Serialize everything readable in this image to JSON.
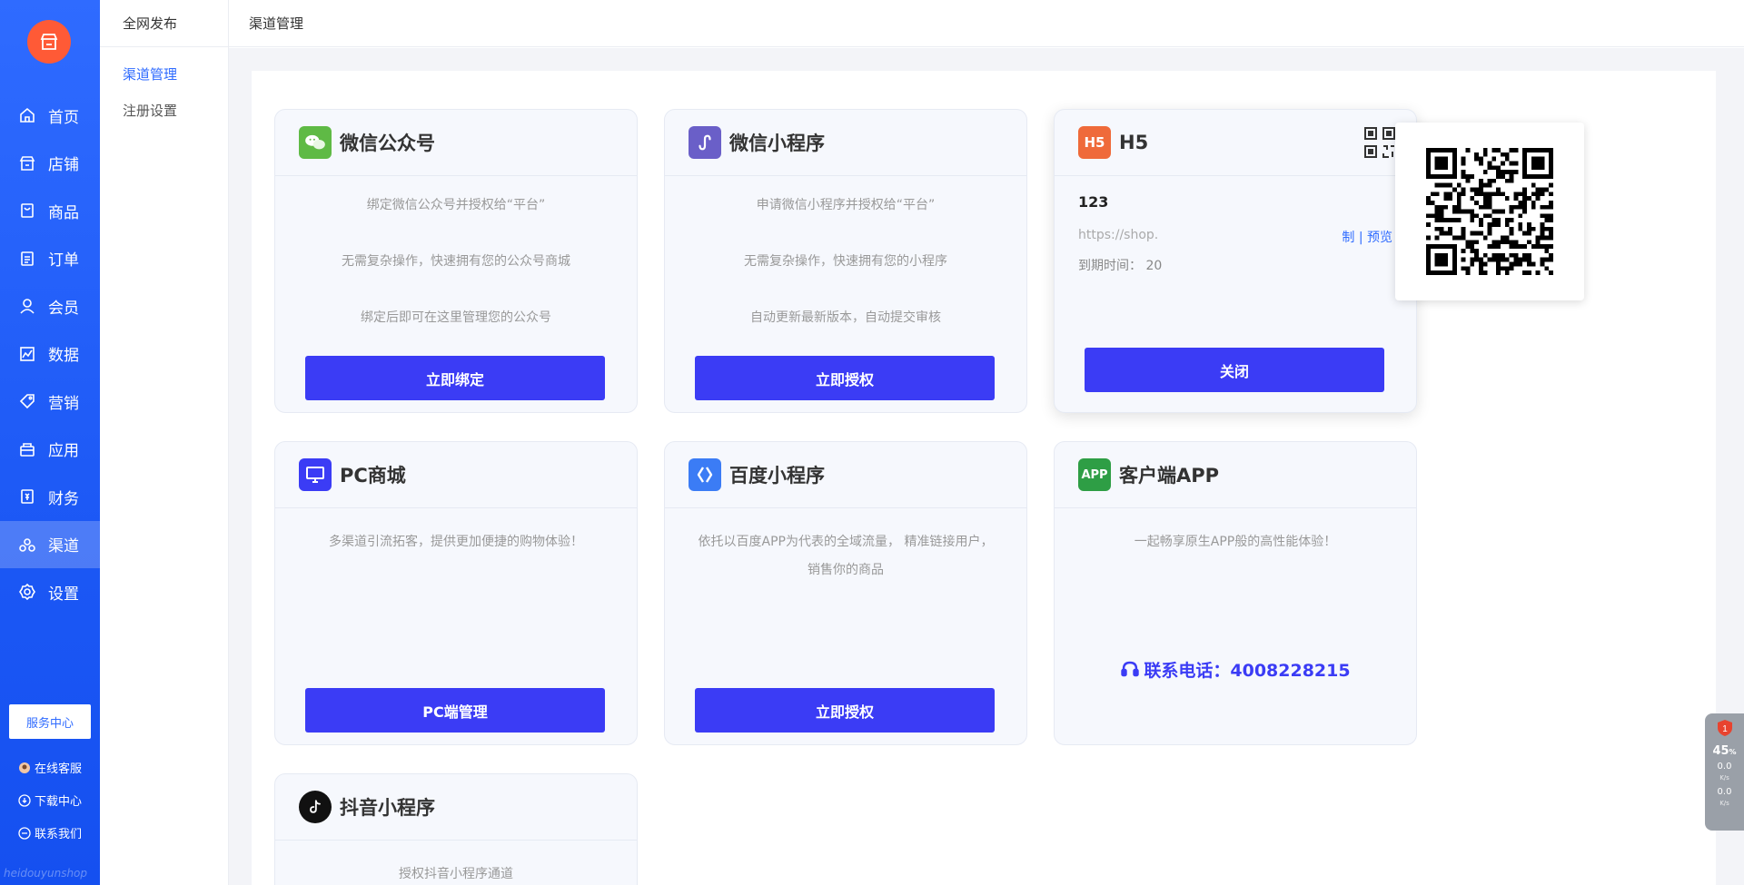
{
  "sidebar": {
    "nav": [
      {
        "label": "首页",
        "icon": "home-icon"
      },
      {
        "label": "店铺",
        "icon": "store-icon"
      },
      {
        "label": "商品",
        "icon": "goods-icon"
      },
      {
        "label": "订单",
        "icon": "order-icon"
      },
      {
        "label": "会员",
        "icon": "member-icon"
      },
      {
        "label": "数据",
        "icon": "chart-icon"
      },
      {
        "label": "营销",
        "icon": "tag-icon"
      },
      {
        "label": "应用",
        "icon": "app-icon"
      },
      {
        "label": "财务",
        "icon": "finance-icon"
      },
      {
        "label": "渠道",
        "icon": "channel-icon",
        "active": true
      },
      {
        "label": "设置",
        "icon": "settings-icon"
      }
    ],
    "service_center": "服务中心",
    "online_service": "在线客服",
    "download_center": "下载中心",
    "contact_us": "联系我们",
    "watermark": "heidouyunshop"
  },
  "submenu": {
    "title": "全网发布",
    "items": [
      "渠道管理",
      "注册设置"
    ]
  },
  "topbar": {
    "title": "渠道管理"
  },
  "cards": {
    "wechat_official": {
      "title": "微信公众号",
      "lines": [
        "绑定微信公众号并授权给“平台”",
        "无需复杂操作，快速拥有您的公众号商城",
        "绑定后即可在这里管理您的公众号"
      ],
      "button": "立即绑定"
    },
    "wechat_mini": {
      "title": "微信小程序",
      "lines": [
        "申请微信小程序并授权给“平台”",
        "无需复杂操作，快速拥有您的小程序",
        "自动更新最新版本，自动提交审核"
      ],
      "button": "立即授权"
    },
    "h5": {
      "icon_text": "H5",
      "title": "H5",
      "name": "123",
      "url": "https://shop.",
      "links": "制 | 预览",
      "expire": "到期时间：  20",
      "button": "关闭"
    },
    "pc": {
      "title": "PC商城",
      "desc": "多渠道引流拓客，提供更加便捷的购物体验！",
      "button": "PC端管理"
    },
    "baidu": {
      "title": "百度小程序",
      "desc": "依托以百度APP为代表的全域流量， 精准链接用户，销售你的商品",
      "button": "立即授权"
    },
    "app": {
      "icon_text": "APP",
      "title": "客户端APP",
      "desc": "一起畅享原生APP般的高性能体验！",
      "phone": "联系电话：4008228215"
    },
    "douyin": {
      "title": "抖音小程序",
      "desc": "授权抖音小程序通道"
    }
  },
  "widget": {
    "badge": "1",
    "percent": "45",
    "percent_unit": "%",
    "up": "0.0",
    "down": "0.0",
    "unit": "K/s"
  },
  "colors": {
    "sidebar": "#2f6bff",
    "button": "#3b3cf5",
    "logo": "#ff5a36",
    "wechat": "#5fba45",
    "mini": "#6a5fc8",
    "h5": "#ef6a3a",
    "pc": "#3b3cf5",
    "baidu": "#3b7cf5",
    "app": "#2e9e45",
    "douyin": "#111111"
  }
}
